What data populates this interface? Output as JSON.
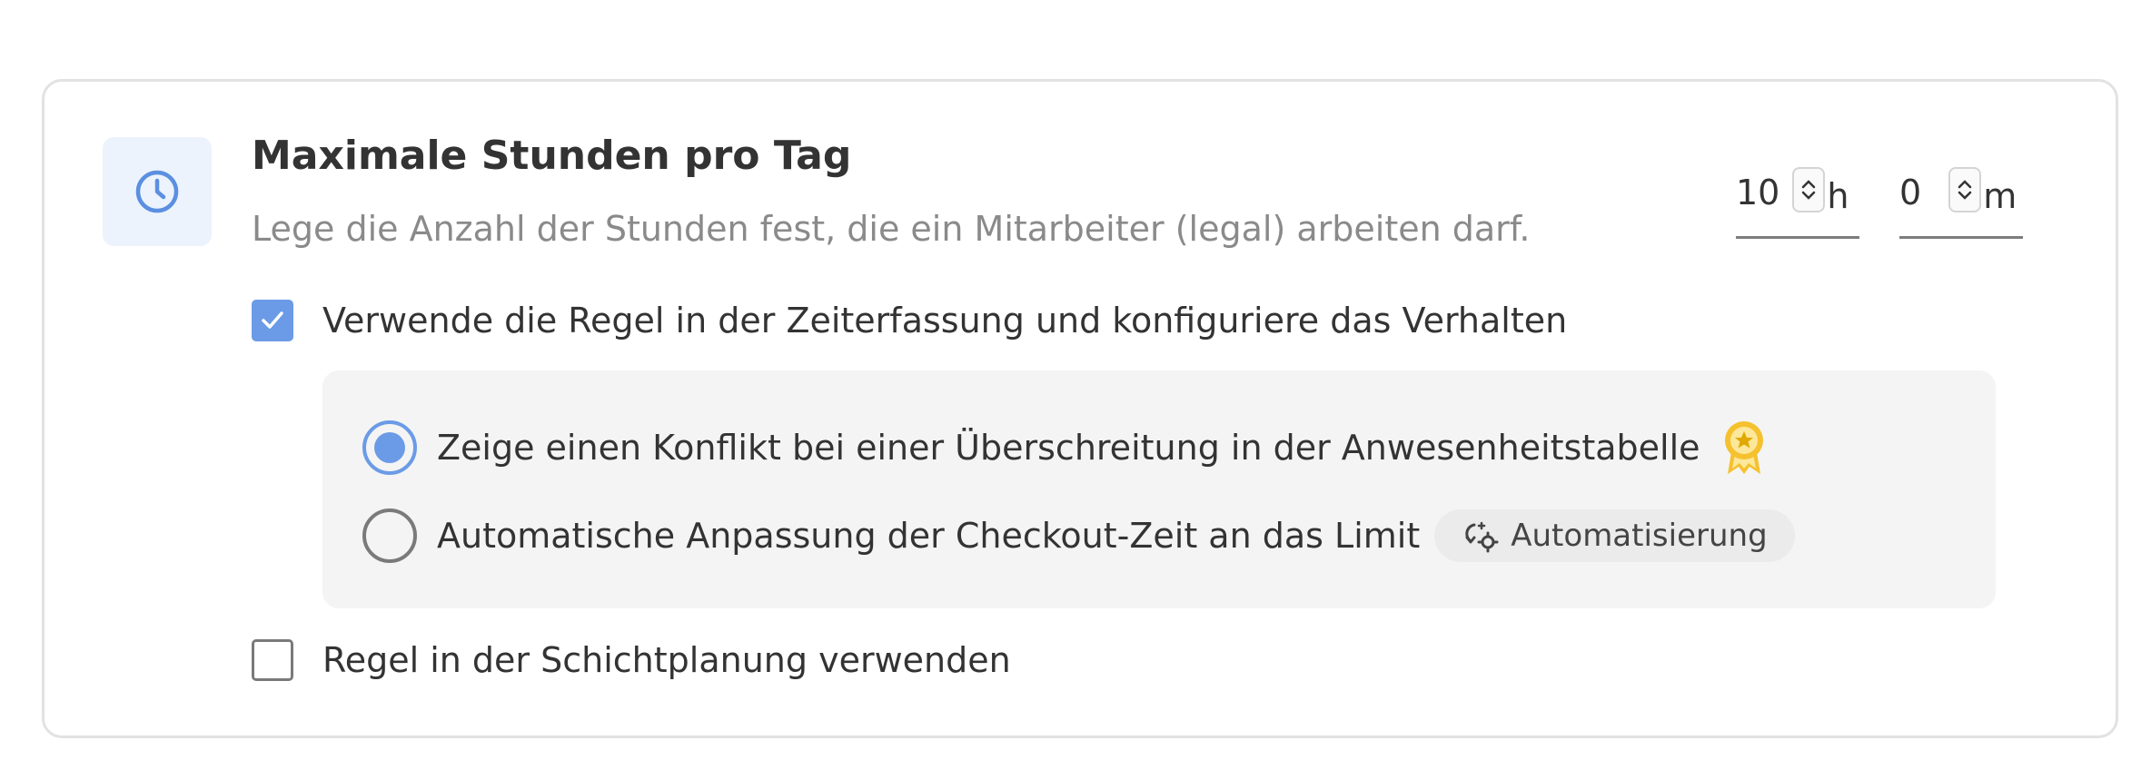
{
  "rule": {
    "title": "Maximale Stunden pro Tag",
    "description": "Lege die Anzahl der Stunden fest, die ein Mitarbeiter (legal) arbeiten darf.",
    "icon": "clock-icon",
    "hours_value": "10",
    "hours_unit": "h",
    "minutes_value": "0",
    "minutes_unit": "m"
  },
  "time_tracking": {
    "label": "Verwende die Regel in der Zeiterfassung und konfiguriere das Verhalten",
    "checked": true,
    "options": [
      {
        "label": "Zeige einen Konflikt bei einer Überschreitung in der Anwesenheitstabelle",
        "selected": true,
        "icon": "premium-badge-icon"
      },
      {
        "label": "Automatische Anpassung der Checkout-Zeit an das Limit",
        "selected": false,
        "badge": "Automatisierung",
        "badge_icon": "automation-icon"
      }
    ]
  },
  "shift_planning": {
    "label": "Regel in der Schichtplanung verwenden",
    "checked": false
  },
  "colors": {
    "accent": "#6b9be6",
    "icon_bg": "#ecf3fd",
    "panel_bg": "#f4f4f4",
    "premium": "#f5c12e"
  }
}
